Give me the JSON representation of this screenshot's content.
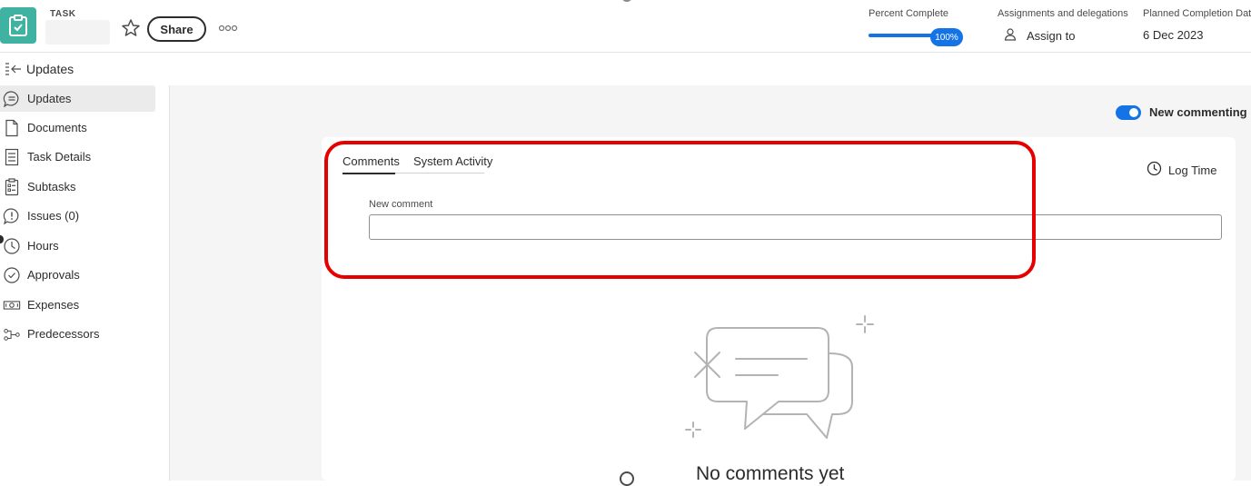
{
  "header": {
    "task_type": "TASK",
    "share_label": "Share",
    "percent_complete_label": "Percent Complete",
    "percent_complete_value": "100%",
    "percent_complete_fraction": 1.0,
    "assignments_label": "Assignments and delegations",
    "assign_to_label": "Assign to",
    "planned_completion_label": "Planned Completion Date",
    "planned_completion_value": "6 Dec 2023"
  },
  "panel": {
    "title": "Updates"
  },
  "sidebar": {
    "items": [
      {
        "label": "Updates",
        "icon": "speech-bubble-icon",
        "active": true
      },
      {
        "label": "Documents",
        "icon": "document-icon",
        "active": false
      },
      {
        "label": "Task Details",
        "icon": "details-icon",
        "active": false
      },
      {
        "label": "Subtasks",
        "icon": "checklist-icon",
        "active": false
      },
      {
        "label": "Issues (0)",
        "icon": "issue-bubble-icon",
        "active": false
      },
      {
        "label": "Hours",
        "icon": "clock-icon",
        "active": false
      },
      {
        "label": "Approvals",
        "icon": "check-circle-icon",
        "active": false
      },
      {
        "label": "Expenses",
        "icon": "money-icon",
        "active": false
      },
      {
        "label": "Predecessors",
        "icon": "flow-icon",
        "active": false
      }
    ]
  },
  "main": {
    "new_commenting_label": "New commenting",
    "new_commenting_on": true,
    "tabs": [
      {
        "label": "Comments",
        "active": true
      },
      {
        "label": "System Activity",
        "active": false
      }
    ],
    "log_time_label": "Log Time",
    "new_comment_label": "New comment",
    "new_comment_value": "",
    "empty_state_text": "No comments yet"
  },
  "colors": {
    "accent": "#1473e6",
    "task_icon": "#3fb2a2",
    "highlight": "#e60000",
    "background": "#f5f5f5"
  }
}
